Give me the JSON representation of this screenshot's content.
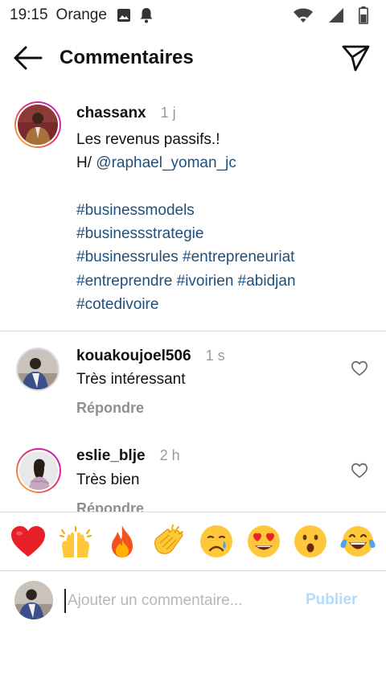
{
  "status_bar": {
    "time": "19:15",
    "carrier": "Orange"
  },
  "header": {
    "title": "Commentaires"
  },
  "caption": {
    "username": "chassanx",
    "time_ago": "1 j",
    "line1": "Les revenus passifs.!",
    "line2_prefix": "H/ ",
    "mention": "@raphael_yoman_jc",
    "hashtags_line1": "#businessmodels",
    "hashtags_line2": "#businessstrategie",
    "hashtags_line3": "#businessrules #entrepreneuriat",
    "hashtags_line4": "#entreprendre #ivoirien #abidjan",
    "hashtags_line5": "#cotedivoire"
  },
  "comments": [
    {
      "username": "kouakoujoel506",
      "time_ago": "1 s",
      "text": "Très intéressant",
      "reply_label": "Répondre"
    },
    {
      "username": "eslie_blje",
      "time_ago": "2 h",
      "text": "Très bien",
      "reply_label": "Répondre"
    }
  ],
  "emoji_bar": [
    "❤️",
    "🙌",
    "🔥",
    "👏",
    "😢",
    "😍",
    "😮",
    "😂"
  ],
  "composer": {
    "placeholder": "Ajouter un commentaire...",
    "publish_label": "Publier"
  },
  "colors": {
    "link": "#1f4f7a",
    "publish_disabled": "#b3dbfb",
    "muted": "#8e8e8e",
    "divider": "#dbdbdb"
  },
  "icons": [
    "image-icon",
    "notification-bell-icon",
    "wifi-icon",
    "signal-icon",
    "battery-icon",
    "back-arrow-icon",
    "send-icon",
    "heart-outline-icon"
  ]
}
